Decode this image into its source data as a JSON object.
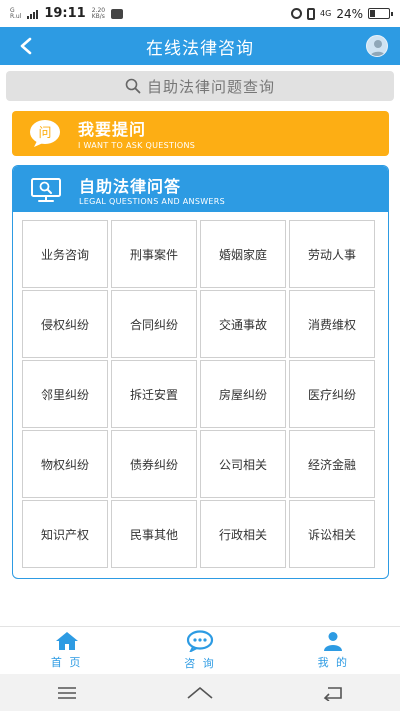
{
  "status": {
    "carrier_top": "G",
    "carrier_bottom": "R.ul",
    "time": "19:11",
    "speed_top": "2.20",
    "speed_bottom": "KB/s",
    "network": "4G",
    "battery": "24%"
  },
  "header": {
    "title": "在线法律咨询"
  },
  "search": {
    "placeholder": "自助法律问题查询"
  },
  "ask": {
    "icon_char": "问",
    "title": "我要提问",
    "subtitle": "I WANT TO ASK QUESTIONS"
  },
  "legal": {
    "title": "自助法律问答",
    "subtitle": "LEGAL QUESTIONS AND ANSWERS",
    "categories": [
      "业务咨询",
      "刑事案件",
      "婚姻家庭",
      "劳动人事",
      "侵权纠纷",
      "合同纠纷",
      "交通事故",
      "消费维权",
      "邻里纠纷",
      "拆迁安置",
      "房屋纠纷",
      "医疗纠纷",
      "物权纠纷",
      "债券纠纷",
      "公司相关",
      "经济金融",
      "知识产权",
      "民事其他",
      "行政相关",
      "诉讼相关"
    ]
  },
  "tabs": [
    {
      "label": "首 页",
      "icon": "home-icon"
    },
    {
      "label": "咨 询",
      "icon": "chat-icon"
    },
    {
      "label": "我 的",
      "icon": "user-icon"
    }
  ],
  "colors": {
    "primary": "#2d9be3",
    "accent": "#fdae14"
  }
}
